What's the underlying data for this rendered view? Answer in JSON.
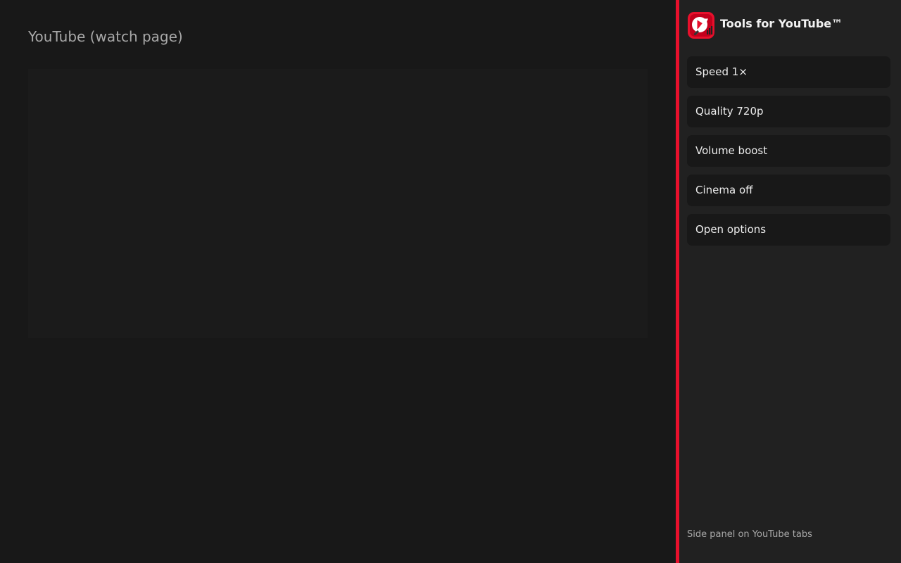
{
  "main": {
    "title": "YouTube (watch page)"
  },
  "panel": {
    "logo_icon": "youtube-tools-icon",
    "title": "Tools for YouTube™",
    "buttons": [
      {
        "label": "Speed 1×"
      },
      {
        "label": "Quality 720p"
      },
      {
        "label": "Volume boost"
      },
      {
        "label": "Cinema off"
      },
      {
        "label": "Open options"
      }
    ],
    "footer": "Side panel on YouTube tabs"
  },
  "colors": {
    "accent": "#e8102c",
    "background": "#181818",
    "panel_background": "#212121",
    "button_background": "#181818"
  }
}
